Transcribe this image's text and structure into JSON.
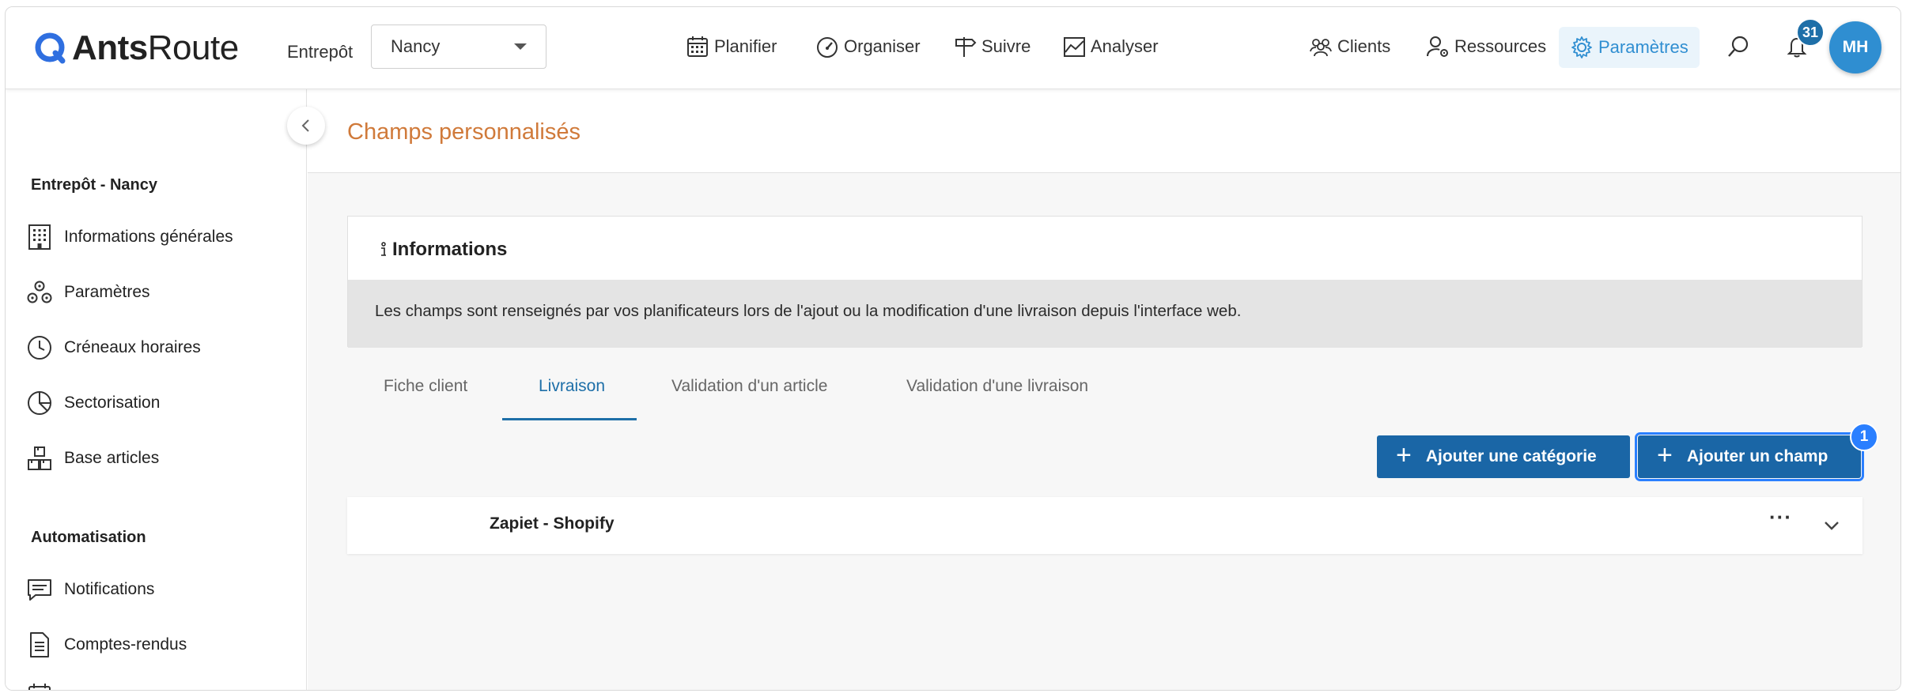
{
  "topbar": {
    "logo": {
      "bold": "Ants",
      "regular": "Route"
    },
    "warehouse_label": "Entrepôt",
    "warehouse_value": "Nancy",
    "nav": [
      {
        "label": "Planifier",
        "icon": "calendar-icon"
      },
      {
        "label": "Organiser",
        "icon": "speedometer-icon"
      },
      {
        "label": "Suivre",
        "icon": "signpost-icon"
      },
      {
        "label": "Analyser",
        "icon": "chart-icon"
      }
    ],
    "right_nav": [
      {
        "label": "Clients",
        "icon": "users-icon"
      },
      {
        "label": "Ressources",
        "icon": "user-gear-icon"
      },
      {
        "label": "Paramètres",
        "icon": "gear-icon",
        "active": true
      }
    ],
    "notifications_count": "31",
    "avatar_initials": "MH"
  },
  "sidebar": {
    "section1_title": "Entrepôt - Nancy",
    "items1": [
      {
        "label": "Informations générales",
        "icon": "building-icon"
      },
      {
        "label": "Paramètres",
        "icon": "cogs-icon"
      },
      {
        "label": "Créneaux horaires",
        "icon": "clock-icon"
      },
      {
        "label": "Sectorisation",
        "icon": "pie-icon"
      },
      {
        "label": "Base articles",
        "icon": "boxes-icon"
      }
    ],
    "section2_title": "Automatisation",
    "items2": [
      {
        "label": "Notifications",
        "icon": "message-icon"
      },
      {
        "label": "Comptes-rendus",
        "icon": "document-icon"
      }
    ]
  },
  "main": {
    "page_title": "Champs personnalisés",
    "info": {
      "title": "Informations",
      "body": "Les champs sont renseignés par vos planificateurs lors de l'ajout ou la modification d'une livraison depuis l'interface web."
    },
    "tabs": [
      {
        "label": "Fiche client",
        "active": false
      },
      {
        "label": "Livraison",
        "active": true
      },
      {
        "label": "Validation d'un article",
        "active": false
      },
      {
        "label": "Validation d'une livraison",
        "active": false
      }
    ],
    "buttons": {
      "add_category": "Ajouter une catégorie",
      "add_field": "Ajouter un champ",
      "step_badge": "1"
    },
    "categories": [
      {
        "name": "Zapiet - Shopify",
        "menu": "···"
      }
    ]
  },
  "colors": {
    "accent": "#1a66a6",
    "title_orange": "#d07a3a",
    "active_nav": "#2f8ed1",
    "highlight": "#2a7fff"
  }
}
